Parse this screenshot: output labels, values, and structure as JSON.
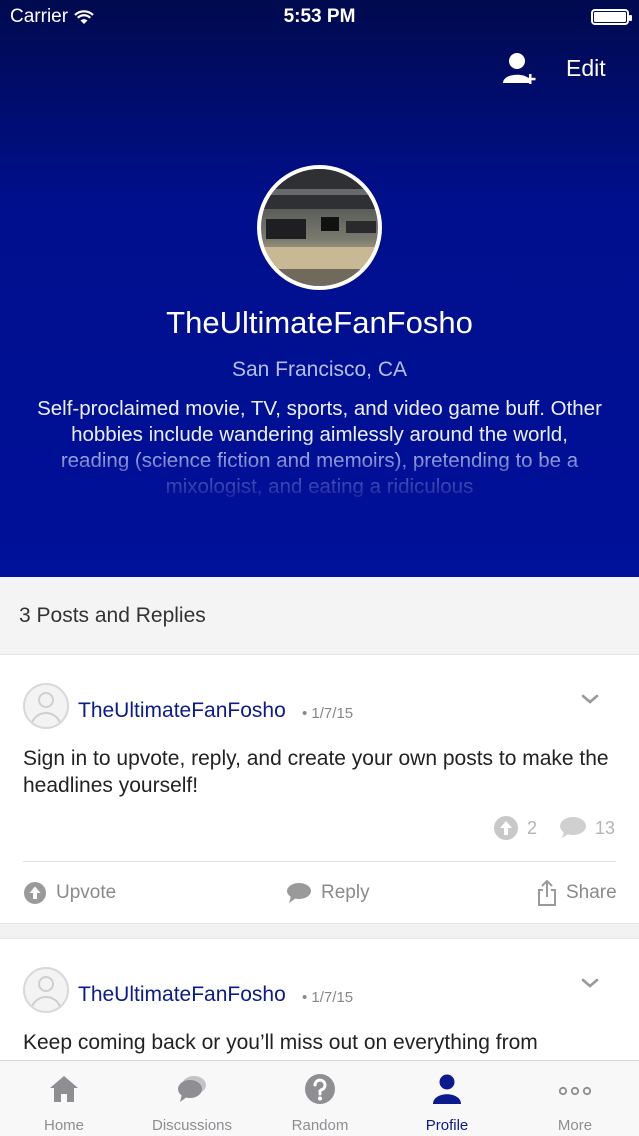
{
  "status_bar": {
    "carrier": "Carrier",
    "time": "5:53 PM"
  },
  "header": {
    "edit_label": "Edit"
  },
  "profile": {
    "username": "TheUltimateFanFosho",
    "location": "San Francisco, CA",
    "bio": "Self-proclaimed movie, TV, sports, and video game buff. Other hobbies include wandering aimlessly around the world, reading (science fiction and memoirs), pretending to be a mixologist, and eating a ridiculous"
  },
  "section": {
    "title": "3 Posts and Replies"
  },
  "posts": [
    {
      "username": "TheUltimateFanFosho",
      "date": "• 1/7/15",
      "text": "Sign in to upvote, reply, and create your own posts to make the headlines yourself!",
      "upvotes": "2",
      "replies": "13",
      "actions": {
        "upvote": "Upvote",
        "reply": "Reply",
        "share": "Share"
      }
    },
    {
      "username": "TheUltimateFanFosho",
      "date": "• 1/7/15",
      "text": "Keep coming back or you’ll miss out on everything from"
    }
  ],
  "tabbar": {
    "items": [
      {
        "label": "Home",
        "icon": "home-icon"
      },
      {
        "label": "Discussions",
        "icon": "chat-bubbles-icon"
      },
      {
        "label": "Random",
        "icon": "question-icon"
      },
      {
        "label": "Profile",
        "icon": "person-icon"
      },
      {
        "label": "More",
        "icon": "more-dots-icon"
      }
    ],
    "active": "Profile"
  },
  "colors": {
    "hero_dark": "#000a4e",
    "hero": "#00119a",
    "accent": "#0b1a8c"
  }
}
